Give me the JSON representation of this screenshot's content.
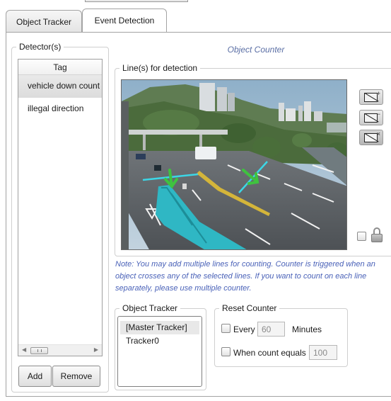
{
  "tabs": [
    {
      "label": "Object Tracker",
      "active": false
    },
    {
      "label": "Event Detection",
      "active": true
    }
  ],
  "detectors": {
    "group_title": "Detector(s)",
    "column_header": "Tag",
    "items": [
      {
        "label": "vehicle down count",
        "selected": true
      },
      {
        "label": "illegal direction",
        "selected": false
      }
    ],
    "add_label": "Add",
    "remove_label": "Remove"
  },
  "counter": {
    "title": "Object Counter",
    "lines_group_title": "Line(s) for detection",
    "tools": [
      {
        "name": "add-line",
        "icon": "line-add-icon",
        "mark": "+"
      },
      {
        "name": "remove-line",
        "icon": "line-remove-icon",
        "mark": "−"
      },
      {
        "name": "clear-lines",
        "icon": "line-clear-icon",
        "mark": "×"
      }
    ],
    "lock_checked": false,
    "note": "Note: You may add multiple lines for counting. Counter is triggered when an object crosses any of the selected lines. If you want to count on each line separately, please use multiple counter."
  },
  "object_tracker": {
    "group_title": "Object Tracker",
    "items": [
      {
        "label": "[Master Tracker]",
        "selected": true
      },
      {
        "label": "Tracker0",
        "selected": false
      }
    ]
  },
  "reset_counter": {
    "group_title": "Reset Counter",
    "every_label": "Every",
    "every_value": "60",
    "minutes_label": "Minutes",
    "every_checked": false,
    "count_equals_label": "When count equals",
    "count_equals_value": "100",
    "count_equals_checked": false
  },
  "colors": {
    "counter_title": "#5b6fa5",
    "note_text": "#4a62b8",
    "detection_line": "#3cd6e6",
    "direction_arrow": "#3fc23f",
    "crane": "#2fb7c4"
  }
}
